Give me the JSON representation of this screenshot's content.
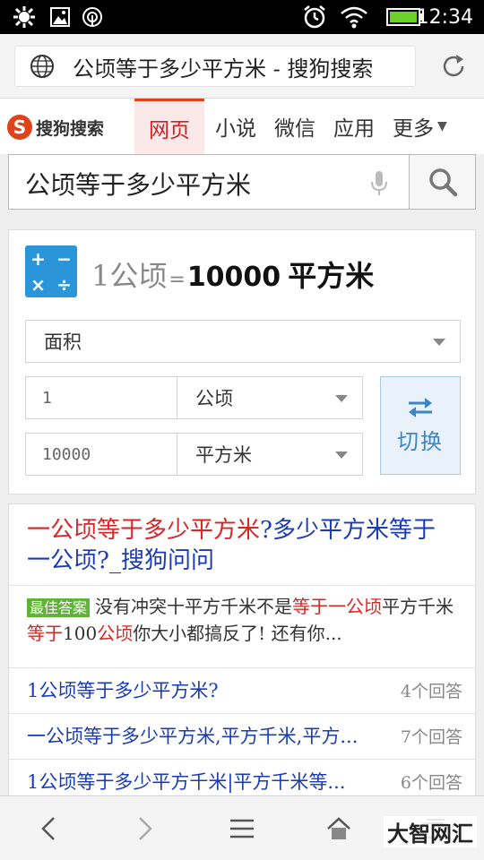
{
  "status_bar": {
    "time": "12:34",
    "icons": [
      "settings-icon",
      "image-icon",
      "hotspot-icon",
      "alarm-icon",
      "wifi-icon",
      "battery-icon"
    ]
  },
  "browser": {
    "url_title": "公顷等于多少平方米 - 搜狗搜索",
    "icons": [
      "globe-icon",
      "reload-icon"
    ]
  },
  "header": {
    "logo_text": "搜狗搜索",
    "logo_mark": "S",
    "tabs": [
      {
        "label": "网页",
        "active": true
      },
      {
        "label": "小说"
      },
      {
        "label": "微信"
      },
      {
        "label": "应用"
      },
      {
        "label": "更多"
      }
    ]
  },
  "search": {
    "query": "公顷等于多少平方米"
  },
  "converter": {
    "calc_symbols": [
      "+",
      "−",
      "×",
      "÷"
    ],
    "result_input": "1公顷",
    "result_eq": "=",
    "result_value": "10000",
    "result_unit": "平方米",
    "category": "面积",
    "from_value": "1",
    "from_unit": "公顷",
    "to_value": "10000",
    "to_unit": "平方米",
    "swap_label": "切换"
  },
  "results": {
    "title_part1": "一公顷等于多少平方米",
    "title_part2": "?多少平方米等于一公顷?_搜狗问问",
    "best_badge": "最佳答案",
    "best_text_a": "没有冲突十平方千米不是",
    "best_text_hl1": "等于一公顷",
    "best_text_b": "平方千米",
    "best_text_hl2": "等于",
    "best_text_c": "100",
    "best_text_hl3": "公顷",
    "best_text_d": "你大小都搞反了! 还有你...",
    "items": [
      {
        "title": "1公顷等于多少平方米?",
        "count": "4个回答"
      },
      {
        "title": "一公顷等于多少平方米,平方千米,平方...",
        "count": "7个回答"
      },
      {
        "title": "1公顷等于多少平方千米|平方千米等...",
        "count": "6个回答"
      }
    ]
  },
  "bottom_bar": {
    "watermark": "大智网汇"
  },
  "colors": {
    "brand_red": "#e2421a",
    "link_blue": "#1a3cb3",
    "highlight_red": "#d62626",
    "calc_blue": "#2a95d8",
    "best_green": "#5fb336"
  }
}
